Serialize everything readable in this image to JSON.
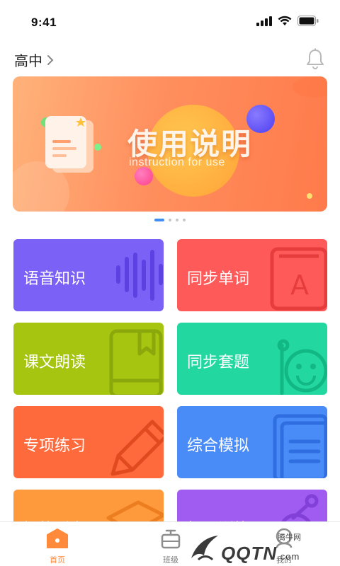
{
  "status_bar": {
    "time": "9:41"
  },
  "header": {
    "grade": "高中"
  },
  "banner": {
    "title": "使用说明",
    "subtitle": "instruction for use",
    "page_count": 4,
    "active_index": 0
  },
  "cards": [
    {
      "label": "语音知识",
      "color": "#7b61f6",
      "icon": "sound-wave-icon"
    },
    {
      "label": "同步单词",
      "color": "#ff5a5a",
      "icon": "letter-a-book-icon"
    },
    {
      "label": "课文朗读",
      "color": "#a6c511",
      "icon": "book-bookmark-icon"
    },
    {
      "label": "同步套题",
      "color": "#22d8a0",
      "icon": "smiley-icon"
    },
    {
      "label": "专项练习",
      "color": "#ff6a3d",
      "icon": "pencil-icon"
    },
    {
      "label": "综合模拟",
      "color": "#4a8cf7",
      "icon": "document-icon"
    },
    {
      "label": "智能听力",
      "color": "#ff9a3c",
      "icon": "shape-icon"
    },
    {
      "label": "拓展训练",
      "color": "#a05cf0",
      "icon": "circle-icon"
    }
  ],
  "tabs": [
    {
      "label": "首页",
      "icon": "home-icon",
      "active": true
    },
    {
      "label": "班级",
      "icon": "class-icon",
      "active": false
    },
    {
      "label": "我的",
      "icon": "profile-icon",
      "active": false
    }
  ],
  "watermark": {
    "small": "腾牛网",
    "big": "QQTN",
    "suffix": ".com"
  }
}
